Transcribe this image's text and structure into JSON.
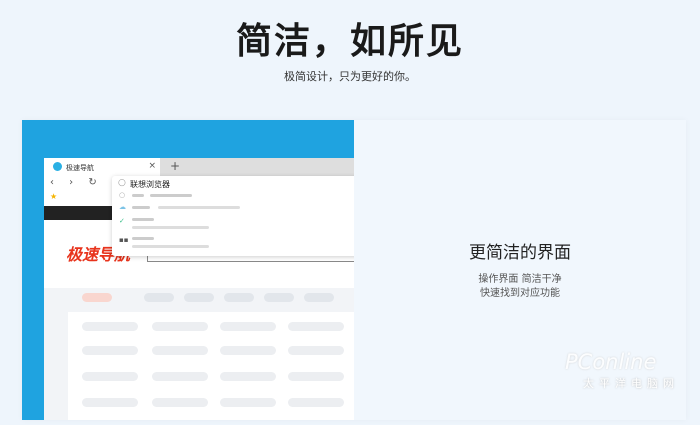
{
  "header": {
    "title": "简洁，如所见",
    "subtitle": "极简设计，只为更好的你。"
  },
  "browser_mock": {
    "tab_label": "极速导航",
    "tab_close": "×",
    "new_tab": "+",
    "nav_icons": "‹ › ↻ ⌂",
    "bookmark_star": "★",
    "search_query": "联想浏览器",
    "logo_text": "极速导航"
  },
  "feature": {
    "heading": "更简洁的界面",
    "line1": "操作界面 简洁干净",
    "line2": "快速找到对应功能"
  },
  "watermark": {
    "brand": "PConline",
    "sub": "太平洋电脑网"
  }
}
